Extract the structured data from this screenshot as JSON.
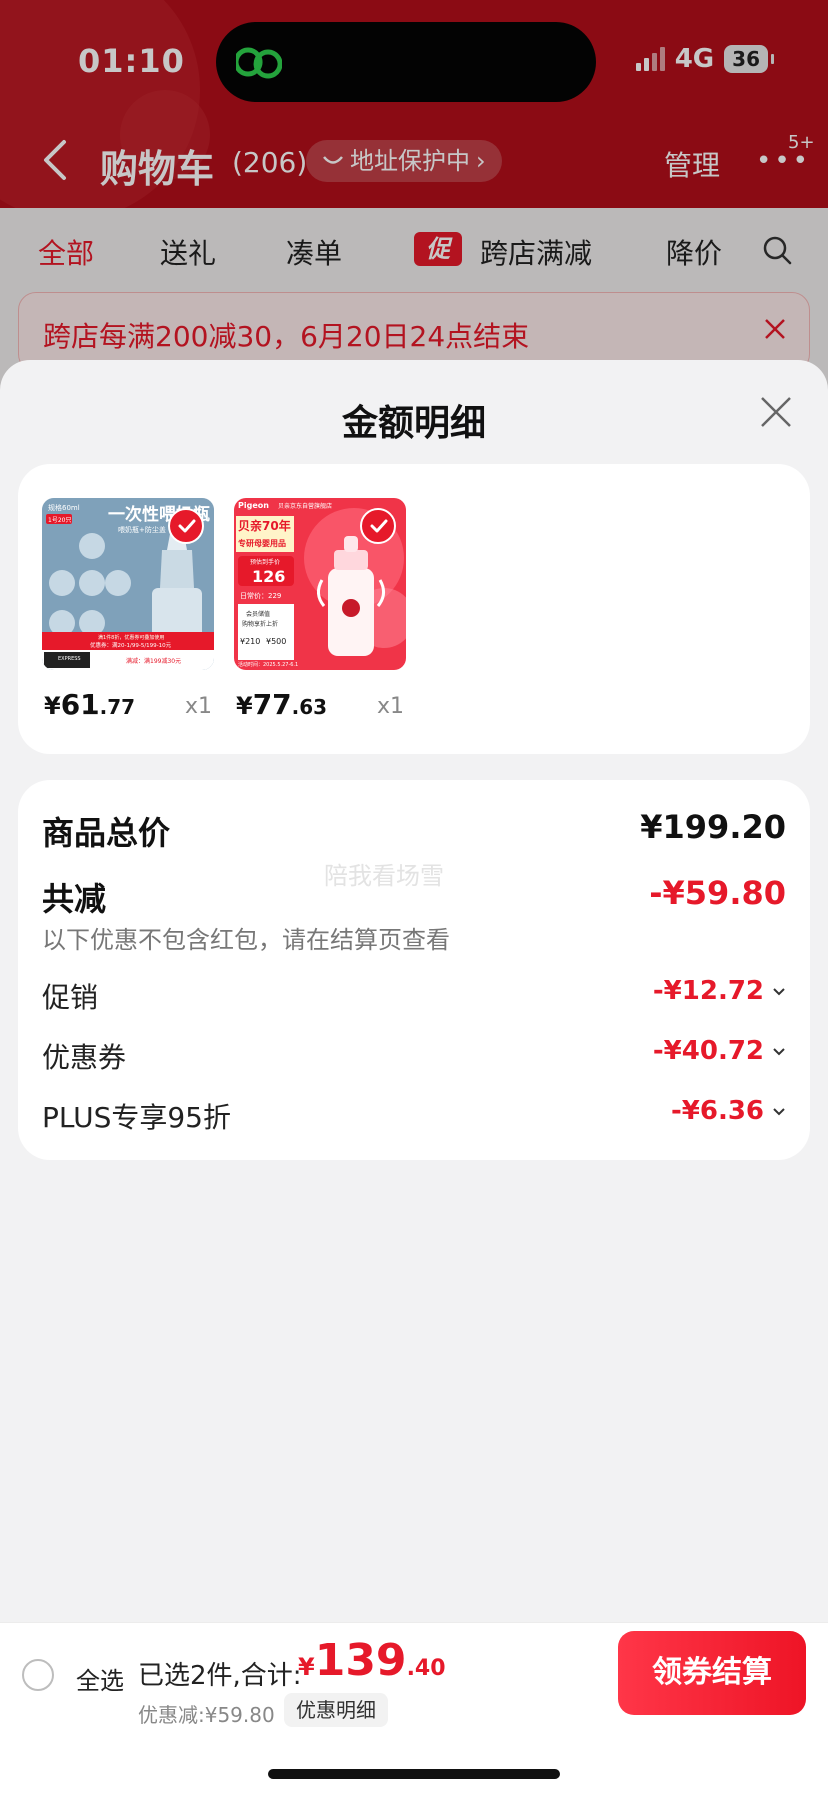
{
  "status": {
    "time": "01:10",
    "network": "4G",
    "battery": "36"
  },
  "cart": {
    "title": "购物车",
    "count": "(206)",
    "address_protect": "地址保护中",
    "manage": "管理",
    "badge": "5+"
  },
  "tabs": {
    "all": "全部",
    "gift": "送礼",
    "bundle": "凑单",
    "promo_tag": "促",
    "cross_store": "跨店满减",
    "price_drop": "降价"
  },
  "notice": {
    "text": "跨店每满200减30，6月20日24点结束"
  },
  "sheet": {
    "title": "金额明细",
    "products": [
      {
        "price_symbol": "¥",
        "price_int": "61",
        "price_dec": ".77",
        "qty": "x1",
        "img_tag1": "规格60ml",
        "img_tag2": "1号20只",
        "img_headline": "一次性喂奶瓶",
        "img_sub": "喂奶瓶+防尘盖",
        "img_promo1": "满1件8折，优惠券可叠加使用",
        "img_promo2": "优惠券：满20-1/99-5/199-10元",
        "img_promo3": "满减：满199减30元",
        "img_express": "EXPRESS"
      },
      {
        "price_symbol": "¥",
        "price_int": "77",
        "price_dec": ".63",
        "qty": "x1",
        "img_brand": "Pigeon",
        "img_store": "贝亲京东自营旗舰店",
        "img_head1": "贝亲70年",
        "img_head2": "专研母婴用品",
        "img_to_hand": "预估到手价",
        "img_price": "126",
        "img_daily": "日常价：229",
        "img_member1": "会员储值",
        "img_member2": "购物享折上折",
        "img_c1": "¥210",
        "img_c2": "¥500",
        "img_time": "活动时间：2025.5.27-6.1"
      }
    ]
  },
  "summary": {
    "total_label": "商品总价",
    "total_value": "¥199.20",
    "watermark": "陪我看场雪",
    "reduce_label": "共减",
    "reduce_value": "-¥59.80",
    "hint": "以下优惠不包含红包，请在结算页查看",
    "items": [
      {
        "label": "促销",
        "value": "-¥12.72"
      },
      {
        "label": "优惠券",
        "value": "-¥40.72"
      },
      {
        "label": "PLUS专享95折",
        "value": "-¥6.36"
      }
    ]
  },
  "checkout": {
    "select_all": "全选",
    "selected_text": "已选2件,合计:",
    "total_symbol": "¥",
    "total_int": "139",
    "total_dec": ".40",
    "discount_text": "优惠减:¥59.80",
    "detail_pill": "优惠明细",
    "button": "领券结算"
  },
  "colors": {
    "brand_red": "#e6192a",
    "header_red": "#b20f1a"
  }
}
